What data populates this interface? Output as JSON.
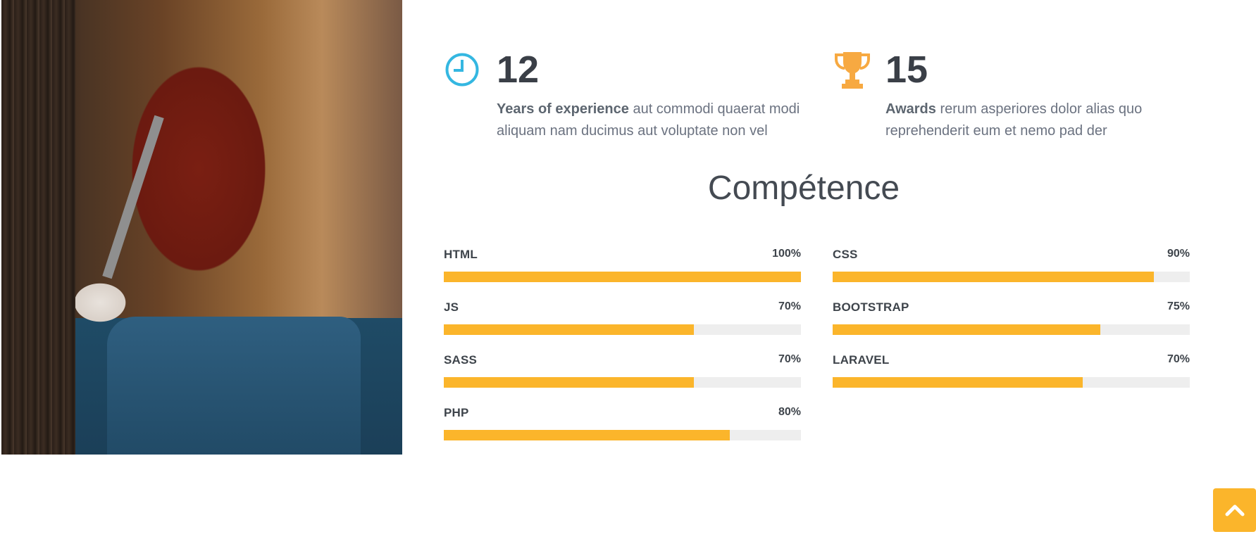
{
  "stats": [
    {
      "number": "12",
      "strong": "Years of experience",
      "text": " aut commodi quaerat modi aliquam nam ducimus aut voluptate non vel",
      "icon": "clock-icon"
    },
    {
      "number": "15",
      "strong": "Awards",
      "text": " rerum asperiores dolor alias quo reprehenderit eum et nemo pad der",
      "icon": "trophy-icon"
    }
  ],
  "section_title": "Compétence",
  "skills": [
    {
      "name": "HTML",
      "value": "100%",
      "level": 1.0
    },
    {
      "name": "CSS",
      "value": "90%",
      "level": 0.9
    },
    {
      "name": "JS",
      "value": "70%",
      "level": 0.7
    },
    {
      "name": "BOOTSTRAP",
      "value": "75%",
      "level": 0.75
    },
    {
      "name": "SASS",
      "value": "70%",
      "level": 0.7
    },
    {
      "name": "LARAVEL",
      "value": "70%",
      "level": 0.7
    },
    {
      "name": "PHP",
      "value": "80%",
      "level": 0.8
    }
  ],
  "colors": {
    "accent": "#fbb52b",
    "clock_icon": "#34b7e1",
    "trophy_icon": "#f7a941",
    "heading": "#3a3f47",
    "text": "#6b7280"
  },
  "back_to_top": {
    "icon": "chevron-up-icon"
  }
}
